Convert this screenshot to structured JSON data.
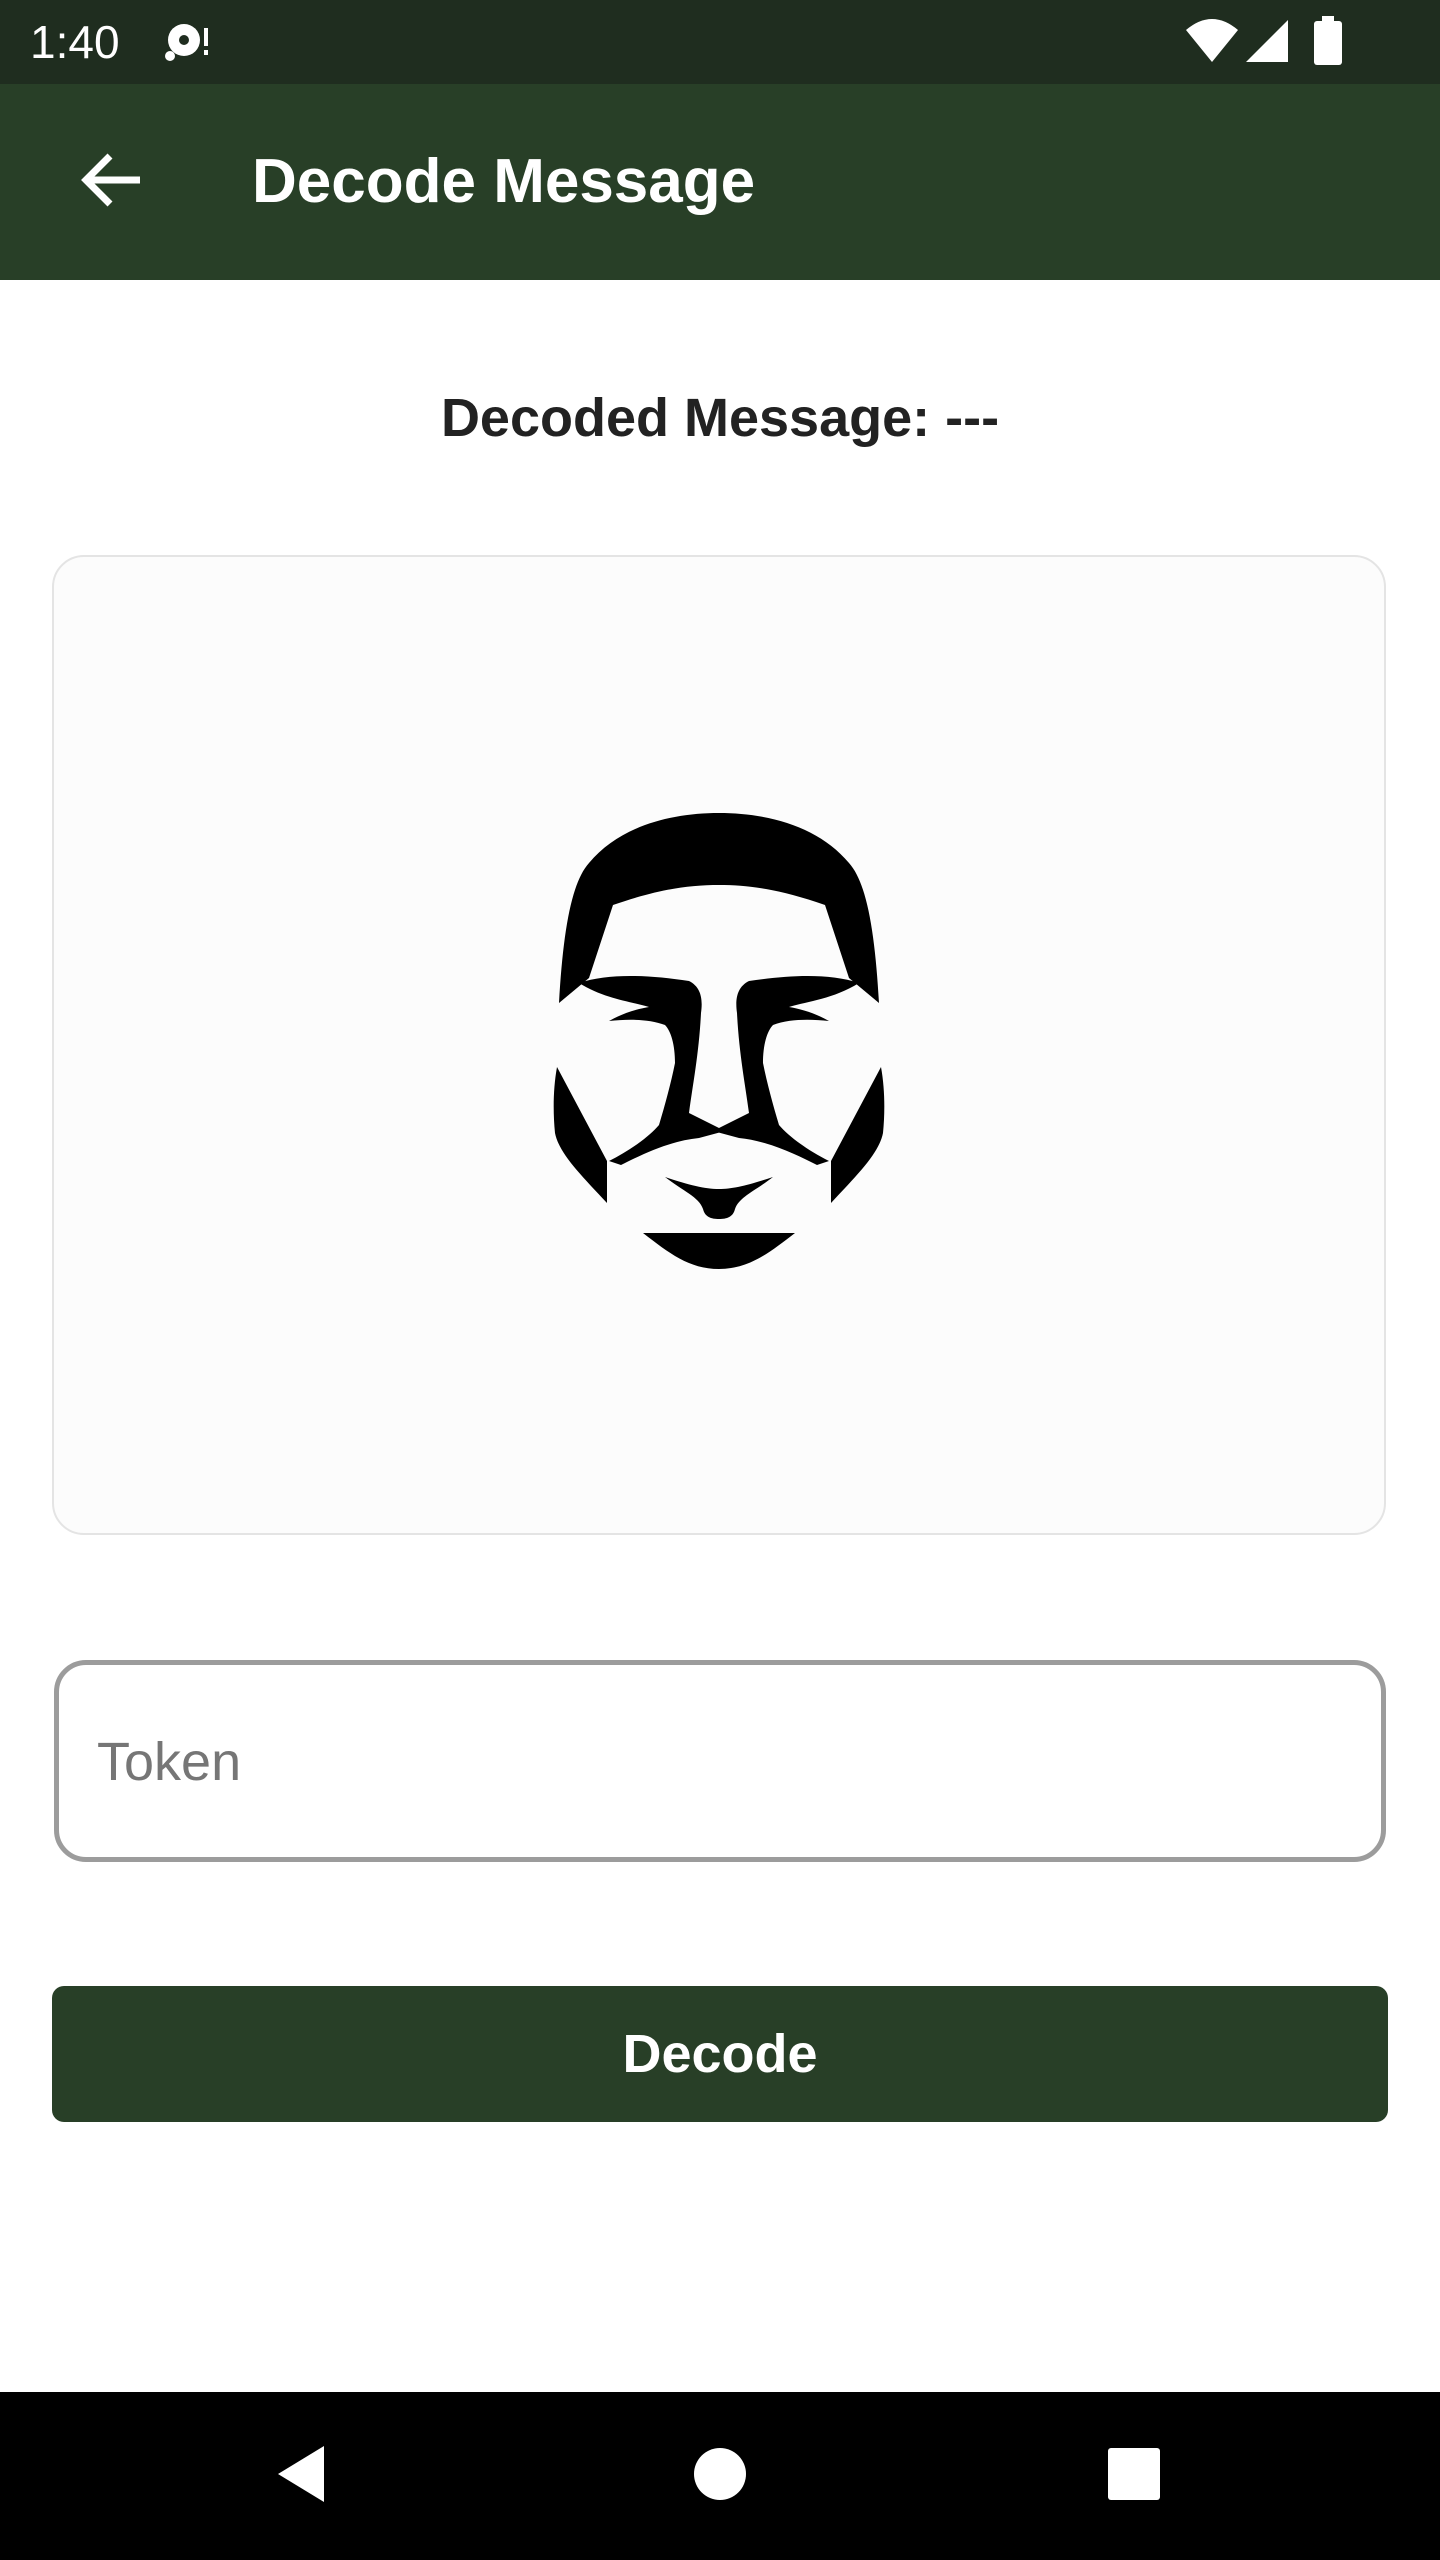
{
  "status_bar": {
    "time": "1:40",
    "icons": [
      "media-notification-icon",
      "wifi-icon",
      "cell-signal-icon",
      "battery-icon"
    ]
  },
  "app_bar": {
    "title": "Decode Message",
    "back_icon": "arrow-back-icon"
  },
  "main": {
    "decoded_label": "Decoded Message: ---",
    "image_icon": "face-mask-icon",
    "token_input": {
      "placeholder": "Token",
      "value": ""
    },
    "decode_button_label": "Decode"
  },
  "nav_bar": {
    "icons": [
      "back-triangle-icon",
      "home-circle-icon",
      "recents-square-icon"
    ]
  },
  "colors": {
    "status_bar": "#1f2d1f",
    "app_bar": "#283f27",
    "button": "#283f27",
    "nav_bar": "#000000"
  }
}
